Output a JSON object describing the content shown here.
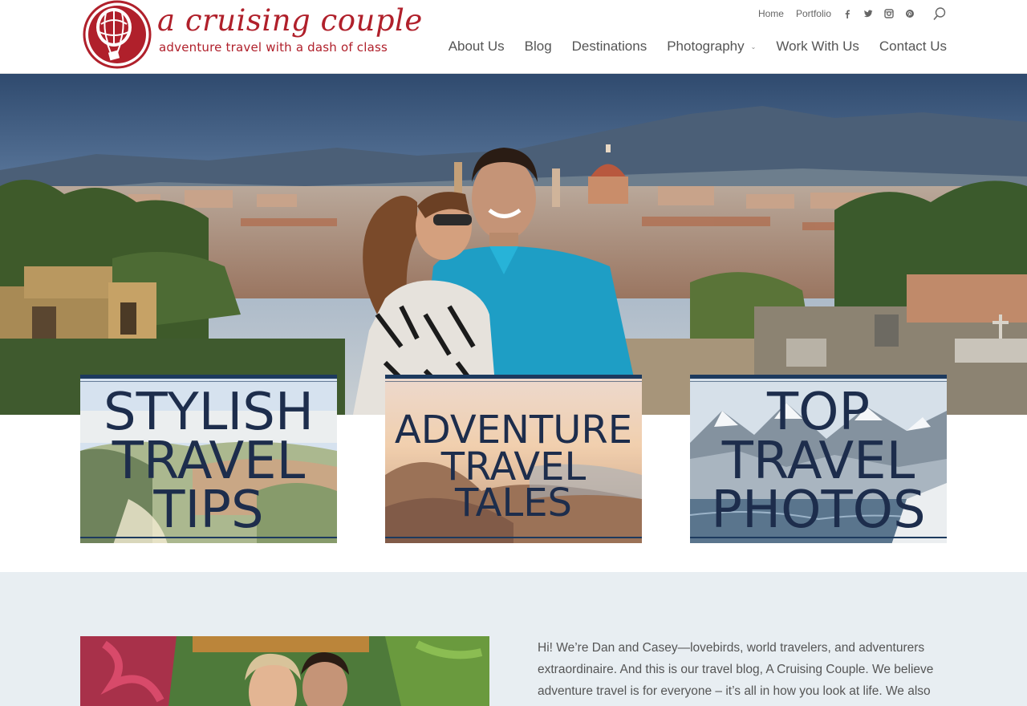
{
  "brand": {
    "title": "a cruising couple",
    "tagline": "adventure travel with a dash of class",
    "color": "#b0202b"
  },
  "topbar": {
    "links": [
      "Home",
      "Portfolio"
    ],
    "social_icons": [
      "facebook-icon",
      "twitter-icon",
      "instagram-icon",
      "pinterest-icon"
    ],
    "search_icon": "search-icon"
  },
  "nav": {
    "items": [
      "About Us",
      "Blog",
      "Destinations",
      "Photography",
      "Work With Us",
      "Contact Us"
    ],
    "dropdown_item": "Photography"
  },
  "cards": [
    {
      "lines": [
        "STYLISH",
        "TRAVEL",
        "TIPS"
      ]
    },
    {
      "lines": [
        "ADVENTURE",
        "TRAVEL",
        "TALES"
      ]
    },
    {
      "lines": [
        "TOP",
        "TRAVEL",
        "PHOTOS"
      ]
    }
  ],
  "intro": {
    "text": "Hi! We’re Dan and Casey—lovebirds, world travelers, and adventurers extraordinaire. And this is our travel blog, A Cruising Couple. We believe adventure travel is for everyone – it’s all in how you look at life. We also"
  },
  "colors": {
    "accent": "#b0202b",
    "card_text": "#1d2d4c",
    "band_bg": "#e8eef2"
  }
}
